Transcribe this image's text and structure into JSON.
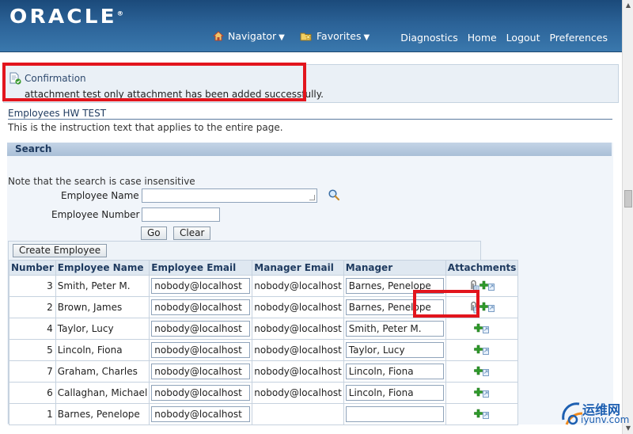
{
  "header": {
    "logo": "ORACLE",
    "logo_mark": "®",
    "navigator": "Navigator",
    "favorites": "Favorites",
    "links": [
      "Diagnostics",
      "Home",
      "Logout",
      "Preferences"
    ]
  },
  "confirmation": {
    "title": "Confirmation",
    "message": "attachment test only attachment has been added successfully."
  },
  "page": {
    "title": "Employees HW TEST",
    "instruction": "This is the instruction text that applies to the entire page."
  },
  "search": {
    "header": "Search",
    "note": "Note that the search is case insensitive",
    "employee_name_label": "Employee Name",
    "employee_name_value": "",
    "employee_number_label": "Employee Number",
    "employee_number_value": "",
    "go_label": "Go",
    "clear_label": "Clear"
  },
  "table": {
    "create_label": "Create Employee",
    "columns": [
      "Number",
      "Employee Name",
      "Employee Email",
      "Manager Email",
      "Manager",
      "Attachments"
    ],
    "rows": [
      {
        "number": "3",
        "name": "Smith, Peter M.",
        "email": "nobody@localhost",
        "manager_email": "nobody@localhost",
        "manager": "Barnes, Penelope",
        "has_attachment": true
      },
      {
        "number": "2",
        "name": "Brown, James",
        "email": "nobody@localhost",
        "manager_email": "nobody@localhost",
        "manager": "Barnes, Penelope",
        "has_attachment": true
      },
      {
        "number": "4",
        "name": "Taylor, Lucy",
        "email": "nobody@localhost",
        "manager_email": "nobody@localhost",
        "manager": "Smith, Peter M.",
        "has_attachment": false
      },
      {
        "number": "5",
        "name": "Lincoln, Fiona",
        "email": "nobody@localhost",
        "manager_email": "nobody@localhost",
        "manager": "Taylor, Lucy",
        "has_attachment": false
      },
      {
        "number": "7",
        "name": "Graham, Charles",
        "email": "nobody@localhost",
        "manager_email": "nobody@localhost",
        "manager": "Lincoln, Fiona",
        "has_attachment": false
      },
      {
        "number": "6",
        "name": "Callaghan, Michael",
        "email": "nobody@localhost",
        "manager_email": "nobody@localhost",
        "manager": "Lincoln, Fiona",
        "has_attachment": false
      },
      {
        "number": "1",
        "name": "Barnes, Penelope",
        "email": "nobody@localhost",
        "manager_email": "",
        "manager": "",
        "has_attachment": false
      }
    ]
  },
  "watermark": {
    "text_cn": "运维网",
    "url": "iyunv.com"
  },
  "icons": {
    "navigator": "home-icon",
    "favorites": "favorites-icon",
    "confirm": "confirmation-icon",
    "search": "search-icon",
    "attachment": "paperclip-icon",
    "add": "add-attachment-icon"
  },
  "colors": {
    "header": "#2b6297",
    "highlight": "#e2151d",
    "add_icon": "#2e9b2a"
  }
}
